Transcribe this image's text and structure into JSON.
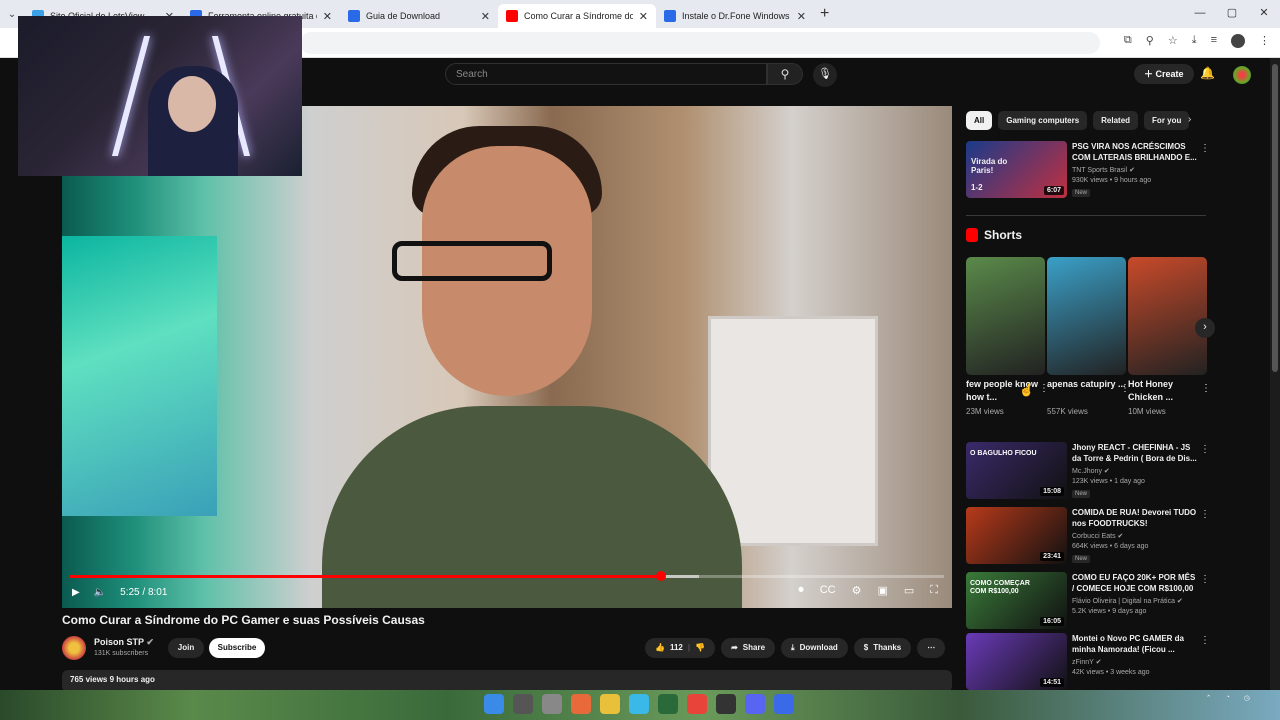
{
  "browser": {
    "tabs": [
      {
        "title": "Site Oficial do LetsView",
        "favicon_color": "#3aa0e8",
        "active": false
      },
      {
        "title": "Ferramenta online gratuita de e",
        "favicon_color": "#2a6ae8",
        "active": false
      },
      {
        "title": "Guia de Download",
        "favicon_color": "#2a6ae8",
        "active": false
      },
      {
        "title": "Como Curar a Síndrome do PC",
        "favicon_color": "#ff0000",
        "active": true
      },
      {
        "title": "Instale o Dr.Fone Windows cor",
        "favicon_color": "#2a6ae8",
        "active": false
      }
    ],
    "new_tab": "+",
    "window_controls": [
      "—",
      "▢",
      "✕"
    ]
  },
  "header": {
    "search_placeholder": "Search",
    "create_label": "Create"
  },
  "player": {
    "time": "5:25 / 8:01",
    "progress_fraction": 0.676,
    "buffered_fraction": 0.72
  },
  "video": {
    "title": "Como Curar a Síndrome do PC Gamer e suas Possíveis Causas",
    "channel": "Poison STP",
    "subscribers": "131K subscribers",
    "join_label": "Join",
    "subscribe_label": "Subscribe",
    "likes": "112",
    "share_label": "Share",
    "download_label": "Download",
    "thanks_label": "Thanks",
    "stats": "765 views  9 hours ago"
  },
  "sidebar": {
    "chips": [
      "All",
      "Gaming computers",
      "Related",
      "For you"
    ],
    "top_rec": {
      "title": "PSG VIRA NOS ACRÉSCIMOS COM LATERAIS BRILHANDO E...",
      "channel": "TNT Sports Brasil",
      "meta": "930K views • 9 hours ago",
      "badge": "New",
      "duration": "6:07",
      "thumb_text": "Virada do Paris!",
      "thumb_score": "1-2"
    },
    "shorts_title": "Shorts",
    "shorts": [
      {
        "title": "few people know how t...",
        "views": "23M views",
        "color": "#5a8a4a"
      },
      {
        "title": "apenas catupiry ...",
        "views": "557K views",
        "color": "#3aa0c8"
      },
      {
        "title": "Hot Honey Chicken ...",
        "views": "10M views",
        "color": "#c84a2a"
      }
    ],
    "recs": [
      {
        "title": "Jhony REACT - CHEFINHA - JS da Torre & Pedrin ( Bora de Dis...",
        "channel": "Mc.Jhony",
        "meta": "123K views • 1 day ago",
        "badge": "New",
        "duration": "15:08",
        "thumb_text": "O BAGULHO FICOU",
        "color": "#3a2a6a"
      },
      {
        "title": "COMIDA DE RUA! Devorei TUDO nos FOODTRUCKS!",
        "channel": "Corbucci Eats",
        "meta": "664K views • 6 days ago",
        "badge": "New",
        "duration": "23:41",
        "thumb_text": "",
        "color": "#b83a1a"
      },
      {
        "title": "COMO EU FAÇO 20K+ POR MÊS / COMECE HOJE COM R$100,00",
        "channel": "Flávio Oliveira | Digital na Prática",
        "meta": "5.2K views • 9 days ago",
        "badge": "",
        "duration": "16:05",
        "thumb_text": "COMO COMEÇAR COM R$100,00",
        "color": "#3a7a3a"
      },
      {
        "title": "Montei o Novo PC GAMER da minha Namorada! (Ficou ...",
        "channel": "zFinnY",
        "meta": "42K views • 3 weeks ago",
        "badge": "",
        "duration": "14:51",
        "thumb_text": "",
        "color": "#6a3ab8"
      }
    ]
  }
}
